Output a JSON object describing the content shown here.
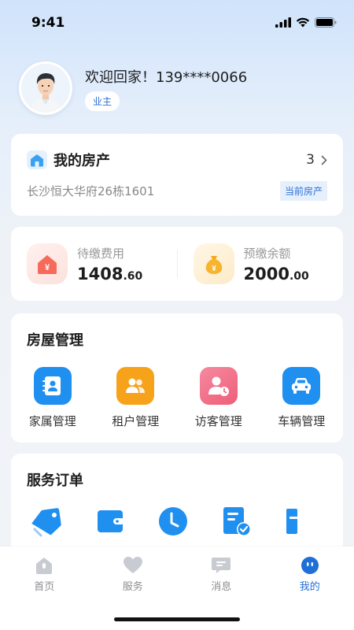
{
  "status_bar": {
    "time": "9:41"
  },
  "profile": {
    "welcome": "欢迎回家！139****0066",
    "role": "业主"
  },
  "property": {
    "title": "我的房产",
    "count": "3",
    "address": "长沙恒大华府26栋1601",
    "current_tag": "当前房产"
  },
  "fees": {
    "pending": {
      "label": "待缴费用",
      "integer": "1408",
      "decimal": ".60"
    },
    "prepaid": {
      "label": "预缴余额",
      "integer": "2000",
      "decimal": ".00"
    }
  },
  "house_management": {
    "title": "房屋管理",
    "items": [
      {
        "label": "家属管理",
        "icon": "family-contact-icon",
        "color": "#1f8ff0"
      },
      {
        "label": "租户管理",
        "icon": "tenant-people-icon",
        "color": "#f7a21b"
      },
      {
        "label": "访客管理",
        "icon": "visitor-clock-icon",
        "color": "#f0617c"
      },
      {
        "label": "车辆管理",
        "icon": "car-icon",
        "color": "#1f8ff0"
      }
    ]
  },
  "service_orders": {
    "title": "服务订单",
    "items": [
      {
        "icon": "tag-icon"
      },
      {
        "icon": "wallet-icon"
      },
      {
        "icon": "clock-icon"
      },
      {
        "icon": "checklist-icon"
      },
      {
        "icon": "document-icon"
      }
    ]
  },
  "tab_bar": {
    "tabs": [
      {
        "label": "首页",
        "icon": "home-icon",
        "active": false
      },
      {
        "label": "服务",
        "icon": "heart-icon",
        "active": false
      },
      {
        "label": "消息",
        "icon": "message-icon",
        "active": false
      },
      {
        "label": "我的",
        "icon": "profile-face-icon",
        "active": true
      }
    ]
  },
  "colors": {
    "accent": "#1f6fd6",
    "blue": "#1f8ff0",
    "orange": "#f7a21b",
    "pink": "#f0617c"
  }
}
